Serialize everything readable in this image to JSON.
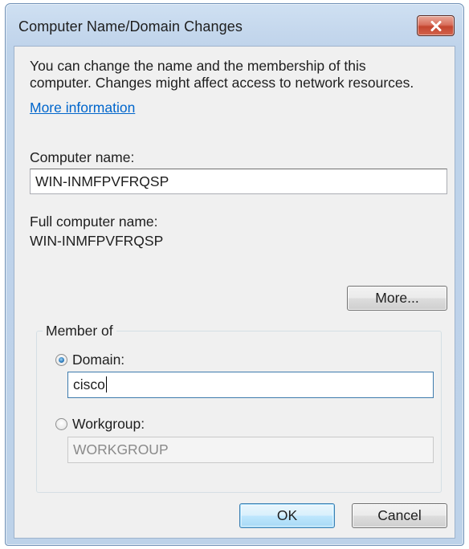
{
  "window": {
    "title": "Computer Name/Domain Changes"
  },
  "intro": {
    "line1": "You can change the name and the membership of this",
    "line2": "computer. Changes might affect access to network resources.",
    "link": "More information"
  },
  "computer_name": {
    "label": "Computer name:",
    "value": "WIN-INMFPVFRQSP"
  },
  "full_computer_name": {
    "label": "Full computer name:",
    "value": "WIN-INMFPVFRQSP"
  },
  "more_button": {
    "label": "More..."
  },
  "member_of": {
    "title": "Member of",
    "domain": {
      "label": "Domain:",
      "value": "cisco",
      "selected": true
    },
    "workgroup": {
      "label": "Workgroup:",
      "value": "WORKGROUP",
      "selected": false
    }
  },
  "buttons": {
    "ok": "OK",
    "cancel": "Cancel"
  },
  "icons": {
    "close": "close-icon"
  },
  "colors": {
    "link": "#0066cc",
    "close_button": "#c4452f",
    "title_bar": "#c3d6ec"
  }
}
